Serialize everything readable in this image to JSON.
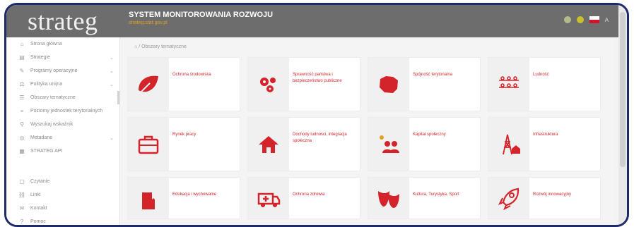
{
  "header": {
    "logo": "strateg",
    "title": "SYSTEM MONITOROWANIA ROZWOJU",
    "subtitle": "strateg.stat.gov.pl",
    "right_text": "A",
    "colors": {
      "bg": "#6d6d6d",
      "dot1": "#b6b98a",
      "dot2": "#c8c12a"
    }
  },
  "sidebar": {
    "items": [
      {
        "label": "Strona główna",
        "icon": "home-icon"
      },
      {
        "label": "Strategie",
        "icon": "strategy-icon",
        "chevron": "⌄"
      },
      {
        "label": "Programy operacyjne",
        "icon": "programs-icon",
        "chevron": "⌄"
      },
      {
        "label": "Polityka unijna",
        "icon": "policy-icon",
        "chevron": "⌄"
      },
      {
        "label": "Obszary tematyczne",
        "icon": "topics-icon"
      },
      {
        "label": "Poziomy jednostek terytorialnych",
        "icon": "territory-icon"
      },
      {
        "label": "Wyszukaj wskaźnik",
        "icon": "search-icon"
      },
      {
        "label": "Metadane",
        "icon": "metadata-icon",
        "chevron": "⌄"
      },
      {
        "label": "STRATEG API",
        "icon": "api-icon"
      }
    ],
    "bottom_items": [
      {
        "label": "Czytanie",
        "icon": "read-icon"
      },
      {
        "label": "Linki",
        "icon": "link-icon"
      },
      {
        "label": "Kontakt",
        "icon": "contact-icon"
      },
      {
        "label": "Pomoc",
        "icon": "help-icon"
      }
    ]
  },
  "breadcrumb": {
    "home": "⌂",
    "sep": "/",
    "current": "Obszary tematyczne"
  },
  "tiles": [
    {
      "label": "Ochrona środowiska",
      "icon": "leaf-icon"
    },
    {
      "label": "Sprawność państwa i bezpieczeństwo publiczne",
      "icon": "gears-icon"
    },
    {
      "label": "Spójność terytorialna",
      "icon": "map-poland-icon"
    },
    {
      "label": "Ludność",
      "icon": "people-icon"
    },
    {
      "label": "Rynek pracy",
      "icon": "briefcase-icon"
    },
    {
      "label": "Dochody ludności, integracja społeczna",
      "icon": "house-icon"
    },
    {
      "label": "Kapitał społeczny",
      "icon": "social-icon"
    },
    {
      "label": "Infrastruktura",
      "icon": "infrastructure-icon"
    },
    {
      "label": "Edukacja i wychowanie",
      "icon": "book-icon"
    },
    {
      "label": "Ochrona zdrowia",
      "icon": "ambulance-icon"
    },
    {
      "label": "Kultura, Turystyka, Sport",
      "icon": "masks-icon"
    },
    {
      "label": "Rozwój innowacyjny",
      "icon": "rocket-icon"
    }
  ],
  "accent": "#d4242b"
}
